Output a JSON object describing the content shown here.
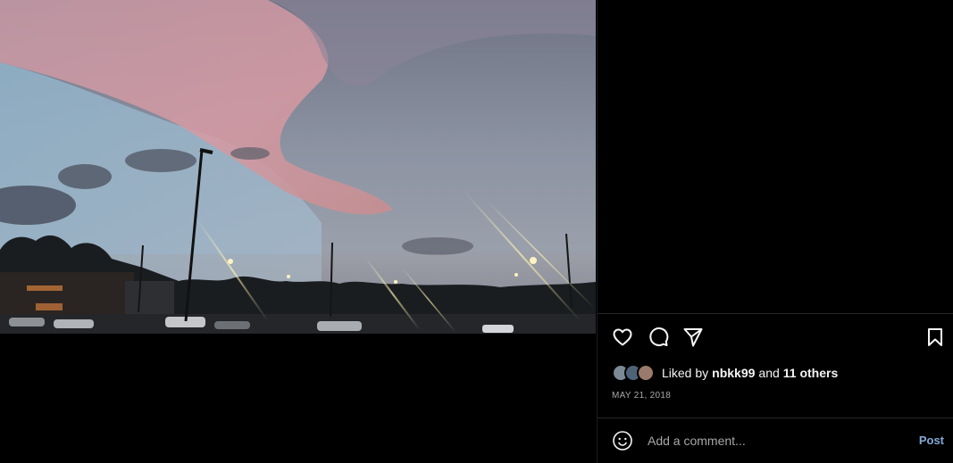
{
  "post": {
    "liked_by_prefix": "Liked by",
    "liked_by_user": "nbkk99",
    "liked_by_and": "and",
    "liked_by_others": "11 others",
    "date": "MAY 21, 2018"
  },
  "actions": {
    "like_icon": "heart-icon",
    "comment_icon": "speech-bubble-icon",
    "share_icon": "paper-plane-icon",
    "save_icon": "bookmark-icon"
  },
  "comment_box": {
    "placeholder": "Add a comment...",
    "post_label": "Post",
    "emoji_icon": "smiley-icon"
  },
  "colors": {
    "background": "#000000",
    "post_button": "#85a9d6",
    "muted_text": "#a8a8a8"
  }
}
